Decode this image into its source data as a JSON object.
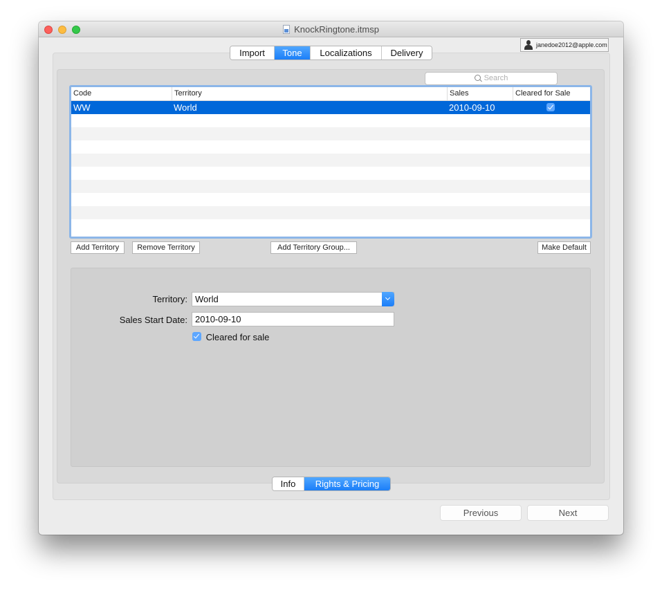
{
  "window": {
    "title": "KnockRingtone.itmsp",
    "account": "janedoe2012@apple.com"
  },
  "top_tabs": [
    {
      "label": "Import",
      "active": false
    },
    {
      "label": "Tone",
      "active": true
    },
    {
      "label": "Localizations",
      "active": false
    },
    {
      "label": "Delivery",
      "active": false
    }
  ],
  "search": {
    "placeholder": "Search"
  },
  "table": {
    "columns": [
      "Code",
      "Territory",
      "Sales",
      "Cleared for Sale"
    ],
    "rows": [
      {
        "code": "WW",
        "territory": "World",
        "sales": "2010-09-10",
        "cleared": true,
        "selected": true
      }
    ]
  },
  "table_buttons": {
    "add": "Add Territory",
    "remove": "Remove Territory",
    "add_group": "Add Territory Group...",
    "make_default": "Make Default"
  },
  "form": {
    "territory_label": "Territory:",
    "territory_value": "World",
    "start_date_label": "Sales Start Date:",
    "start_date_value": "2010-09-10",
    "cleared_label": "Cleared for sale",
    "cleared_checked": true
  },
  "bottom_tabs": [
    {
      "label": "Info",
      "active": false
    },
    {
      "label": "Rights & Pricing",
      "active": true
    }
  ],
  "nav": {
    "previous": "Previous",
    "next": "Next"
  },
  "colors": {
    "accent": "#1b7ef8",
    "selection": "#0067d9",
    "table_focus": "#8cb6e8"
  }
}
